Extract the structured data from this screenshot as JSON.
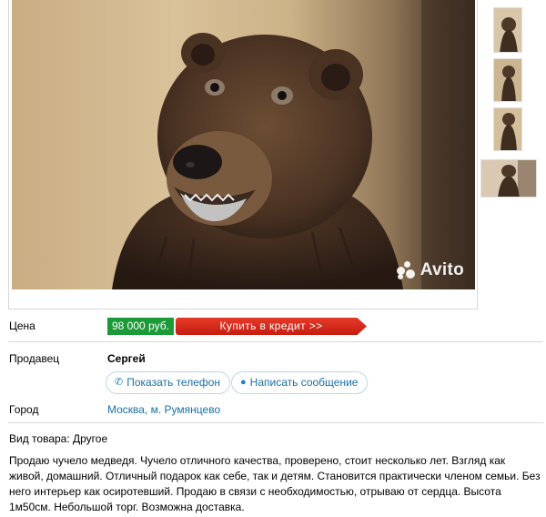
{
  "photo": {
    "watermark": "Avito",
    "alt": "Чучело медведя"
  },
  "thumbnails": [
    {
      "name": "thumb-1"
    },
    {
      "name": "thumb-2"
    },
    {
      "name": "thumb-3"
    },
    {
      "name": "thumb-4"
    }
  ],
  "price": {
    "label": "Цена",
    "value": "98 000 руб.",
    "credit_button": "Купить в кредит >>"
  },
  "seller": {
    "label": "Продавец",
    "name": "Сергей",
    "show_phone": "Показать телефон",
    "write_message": "Написать сообщение"
  },
  "city": {
    "label": "Город",
    "value": "Москва, м. Румянцево"
  },
  "goods_type": "Вид товара: Другое",
  "description": "Продаю чучело медведя. Чучело отличного качества, проверено, стоит несколько лет. Взгляд как живой, домашний. Отличный подарок как себе, так и детям. Становится практически членом семьи. Без него интерьер как осиротевший. Продаю в связи с необходимостью, отрываю от сердца. Высота 1м50см. Небольшой торг. Возможна доставка.",
  "colors": {
    "price_green": "#1b9a37",
    "credit_red": "#d4291a",
    "link_blue": "#1a6fa9"
  },
  "icons": {
    "phone": "phone-icon",
    "message": "message-icon"
  }
}
